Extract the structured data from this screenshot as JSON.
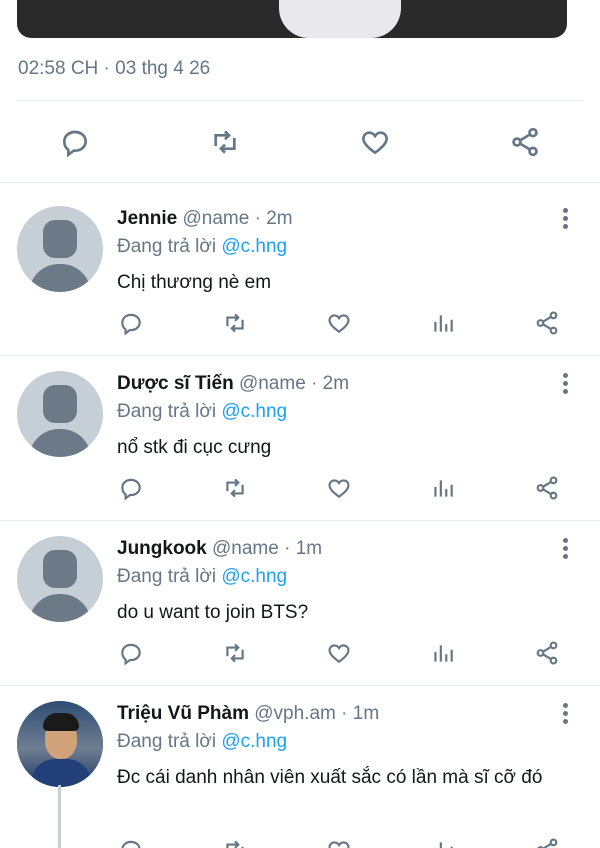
{
  "tweet": {
    "timestamp": "02:58 CH · 03 thg 4 26",
    "actions": [
      "reply-icon",
      "retweet-icon",
      "like-icon",
      "share-icon"
    ]
  },
  "replies": [
    {
      "name": "Jennie",
      "handle": "@name",
      "dot": "·",
      "time": "2m",
      "replying_prefix": "Đang trả lời ",
      "replying_to": "@c.hng",
      "text": "Chị thương nè em",
      "avatar": "default-avatar"
    },
    {
      "name": "Dược sĩ Tiến",
      "handle": "@name",
      "dot": "·",
      "time": "2m",
      "replying_prefix": "Đang trả lời ",
      "replying_to": "@c.hng",
      "text": "nổ stk đi cục cưng",
      "avatar": "default-avatar"
    },
    {
      "name": "Jungkook",
      "handle": "@name",
      "dot": "·",
      "time": "1m",
      "replying_prefix": "Đang trả lời ",
      "replying_to": "@c.hng",
      "text": "do u want to join BTS?",
      "avatar": "default-avatar"
    },
    {
      "name": "Triệu Vũ Phàm",
      "handle": "@vph.am",
      "dot": "·",
      "time": "1m",
      "replying_prefix": "Đang trả lời ",
      "replying_to": "@c.hng",
      "text": "Đc cái danh nhân viên xuất sắc có lần mà sĩ cỡ đó",
      "avatar": "photo-avatar"
    }
  ],
  "colors": {
    "secondary_text": "#657786",
    "mention": "#1da1f2",
    "divider": "#e6ecf0"
  }
}
